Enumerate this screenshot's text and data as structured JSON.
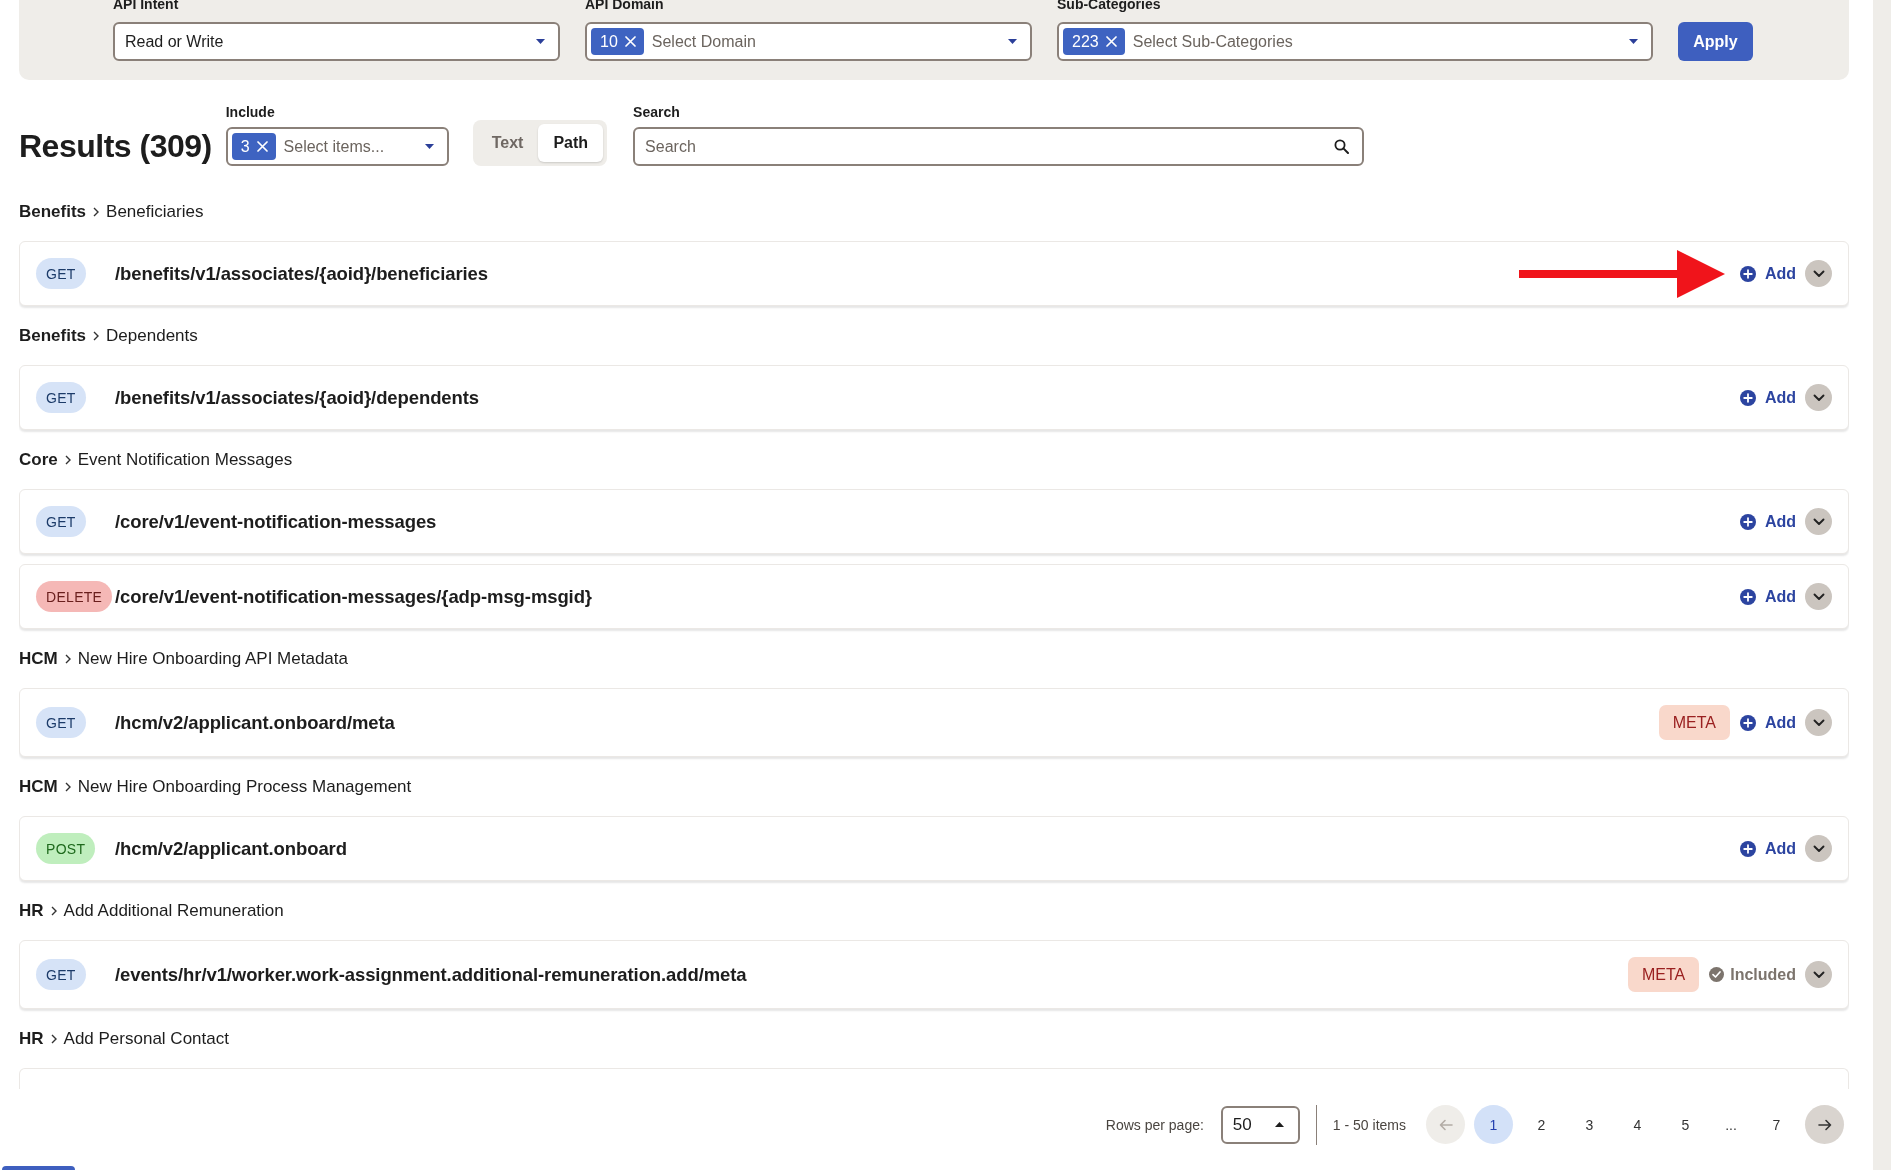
{
  "filters": {
    "fields": [
      {
        "kind": "select",
        "label": "API Intent",
        "value": "Read or Write"
      },
      {
        "kind": "multiselect",
        "label": "API Domain",
        "chip": "10",
        "placeholder": "Select Domain"
      },
      {
        "kind": "multiselect",
        "label": "Sub-Categories",
        "chip": "223",
        "placeholder": "Select Sub-Categories"
      }
    ],
    "apply_button": "Apply"
  },
  "results": {
    "title": "Results (309)",
    "include": {
      "label": "Include",
      "chip": "3",
      "placeholder": "Select items..."
    },
    "view_toggle": [
      {
        "label": "Text",
        "selected": false
      },
      {
        "label": "Path",
        "selected": true
      }
    ],
    "search": {
      "label": "Search",
      "placeholder": "Search"
    }
  },
  "groups": [
    {
      "category": "Benefits",
      "subcategory": "Beneficiaries",
      "endpoints": [
        {
          "method": "GET",
          "color": "#d6e3f7",
          "path": "/benefits/v1/associates/{aoid}/beneficiaries",
          "action": {
            "label": "Add",
            "included": false
          },
          "expanded": false,
          "arrow": true
        }
      ]
    },
    {
      "category": "Benefits",
      "subcategory": "Dependents",
      "endpoints": [
        {
          "method": "GET",
          "color": "#d6e3f7",
          "path": "/benefits/v1/associates/{aoid}/dependents",
          "action": {
            "label": "Add",
            "included": false
          },
          "expanded": false,
          "arrow": false
        }
      ]
    },
    {
      "category": "Core",
      "subcategory": "Event Notification Messages",
      "endpoints": [
        {
          "method": "GET",
          "color": "#d6e3f7",
          "path": "/core/v1/event-notification-messages",
          "action": {
            "label": "Add",
            "included": false
          },
          "expanded": false,
          "arrow": false
        },
        {
          "method": "DELETE",
          "color": "#f5b8b6",
          "path": "/core/v1/event-notification-messages/{adp-msg-msgid}",
          "action": {
            "label": "Add",
            "included": false
          },
          "expanded": false,
          "arrow": false
        }
      ]
    },
    {
      "category": "HCM",
      "subcategory": "New Hire Onboarding API Metadata",
      "endpoints": [
        {
          "method": "GET",
          "color": "#d6e3f7",
          "path": "/hcm/v2/applicant.onboard/meta",
          "tags": [
            "META"
          ],
          "action": {
            "label": "Add",
            "included": false
          },
          "expanded": false,
          "arrow": false
        }
      ]
    },
    {
      "category": "HCM",
      "subcategory": "New Hire Onboarding Process Management",
      "endpoints": [
        {
          "method": "POST",
          "color": "#bfeebd",
          "path": "/hcm/v2/applicant.onboard",
          "action": {
            "label": "Add",
            "included": false
          },
          "expanded": false,
          "arrow": false
        }
      ]
    },
    {
      "category": "HR",
      "subcategory": "Add Additional Remuneration",
      "endpoints": [
        {
          "method": "GET",
          "color": "#d6e3f7",
          "path": "/events/hr/v1/worker.work-assignment.additional-remuneration.add/meta",
          "tags": [
            "META"
          ],
          "action": {
            "label": "Included",
            "included": true
          },
          "expanded": false,
          "arrow": false
        }
      ]
    },
    {
      "category": "HR",
      "subcategory": "Add Personal Contact"
    }
  ],
  "pagination": {
    "rows_label": "Rows per page:",
    "rows_value": "50",
    "range": "1 - 50 items",
    "previous": {
      "disabled": true
    },
    "pages": [
      {
        "kind": "page",
        "label": "1",
        "selected": true
      },
      {
        "kind": "page",
        "label": "2",
        "selected": false
      },
      {
        "kind": "page",
        "label": "3",
        "selected": false
      },
      {
        "kind": "page",
        "label": "4",
        "selected": false
      },
      {
        "kind": "page",
        "label": "5",
        "selected": false
      },
      {
        "kind": "gap",
        "label": "...",
        "selected": false
      },
      {
        "kind": "page",
        "label": "7",
        "selected": false
      }
    ],
    "next": {
      "disabled": false
    }
  }
}
